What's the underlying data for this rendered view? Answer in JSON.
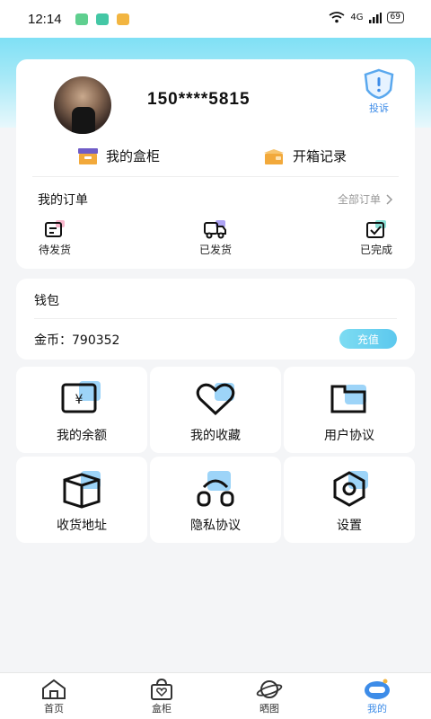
{
  "status_bar": {
    "time": "12:14",
    "network": "4G",
    "battery": "69",
    "app_icon_colors": [
      "#5fcf8f",
      "#44c7a5",
      "#f2b541"
    ]
  },
  "profile": {
    "phone": "150****5815",
    "complain_label": "投诉",
    "avatar_icon": "user-photo"
  },
  "quick_links": [
    {
      "label": "我的盒柜",
      "icon": "box-icon"
    },
    {
      "label": "开箱记录",
      "icon": "open-box-icon"
    }
  ],
  "orders": {
    "title": "我的订单",
    "all_label": "全部订单",
    "items": [
      {
        "label": "待发货",
        "icon": "pending-ship-icon"
      },
      {
        "label": "已发货",
        "icon": "truck-icon"
      },
      {
        "label": "已完成",
        "icon": "check-icon"
      }
    ]
  },
  "wallet": {
    "title": "钱包",
    "coins_label": "金币：",
    "coins_value": "790352",
    "recharge_label": "充值"
  },
  "menu": [
    {
      "label": "我的余额",
      "icon": "balance-icon"
    },
    {
      "label": "我的收藏",
      "icon": "heart-icon"
    },
    {
      "label": "用户协议",
      "icon": "agreement-icon"
    },
    {
      "label": "收货地址",
      "icon": "package-icon"
    },
    {
      "label": "隐私协议",
      "icon": "privacy-icon"
    },
    {
      "label": "设置",
      "icon": "settings-icon"
    }
  ],
  "tabbar": [
    {
      "label": "首页",
      "icon": "home-icon",
      "active": false
    },
    {
      "label": "盒柜",
      "icon": "bag-icon",
      "active": false
    },
    {
      "label": "晒图",
      "icon": "planet-icon",
      "active": false
    },
    {
      "label": "我的",
      "icon": "profile-icon",
      "active": true
    }
  ],
  "colors": {
    "accent": "#3d8ce8",
    "hero_gradient_top": "#7fe0f5",
    "recharge_button": "#6fd3f0",
    "box_icon": "#f2a93b",
    "box_icon_lid": "#6f5cc7"
  }
}
